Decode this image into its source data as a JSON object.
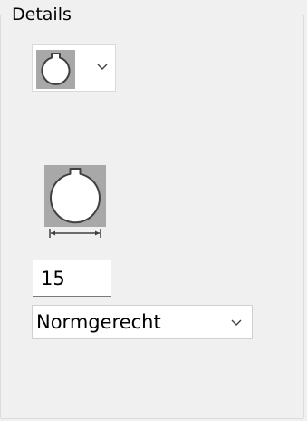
{
  "group": {
    "title": "Details"
  },
  "shape_selector": {
    "selected_icon": "keyed-circle-icon",
    "dropdown_icon": "chevron-down-icon"
  },
  "preview": {
    "icon": "keyed-circle-icon",
    "dimension_icon": "diameter-dimension-icon"
  },
  "size_field": {
    "value": "15"
  },
  "type_select": {
    "selected": "Normgerecht"
  },
  "colors": {
    "panel_background": "#f0f0f0",
    "shape_background": "#a8a8a8",
    "shape_fill": "#ffffff",
    "shape_stroke": "#404040"
  }
}
